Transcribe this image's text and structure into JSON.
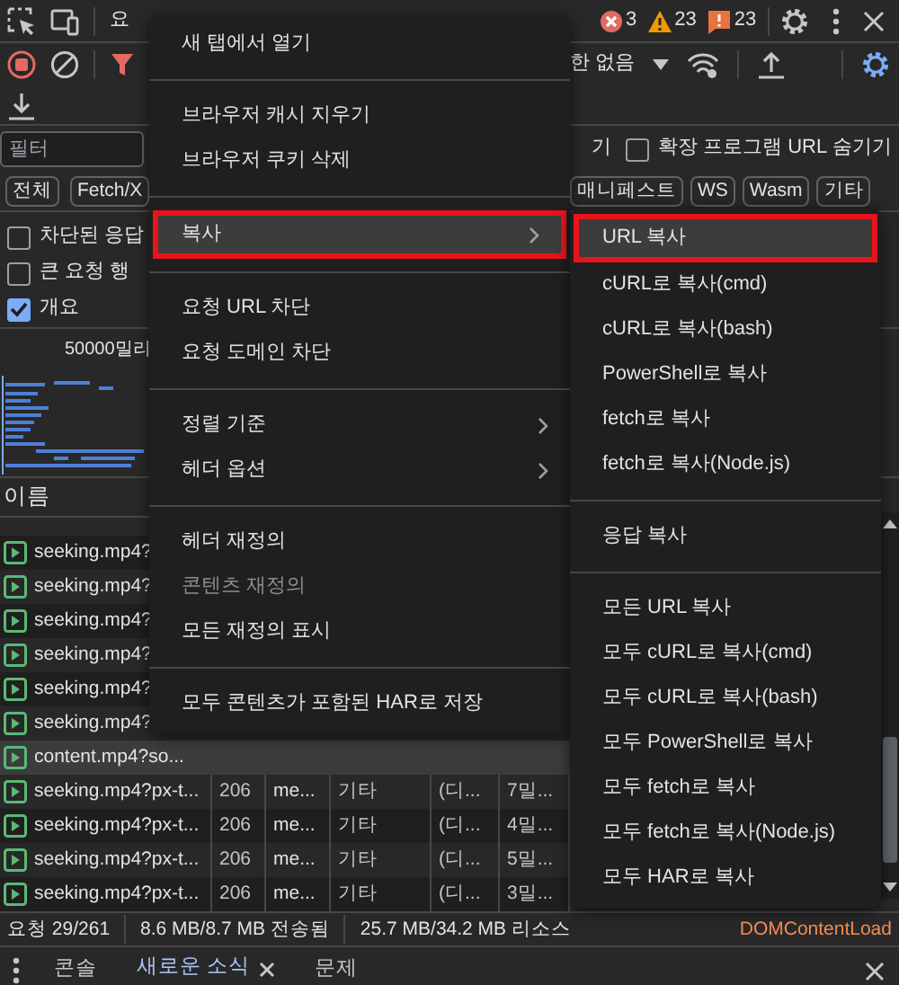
{
  "top_bar": {
    "tab_partial": "요",
    "errors": "3",
    "warnings": "23",
    "issues": "23"
  },
  "toolbar": {
    "throttle_partial": "한 없음"
  },
  "filter_row": {
    "placeholder": "필터",
    "partial_label": "기",
    "hide_extension_urls": {
      "label": "확장 프로그램 URL 숨기기",
      "checked": false
    }
  },
  "type_chips_left": [
    "전체",
    "Fetch/X"
  ],
  "type_chips_right": [
    "매니페스트",
    "WS",
    "Wasm",
    "기타"
  ],
  "options": [
    {
      "label": "차단된 응답",
      "checked": false
    },
    {
      "label": "큰 요청 행",
      "checked": false
    },
    {
      "label": "개요",
      "checked": true
    }
  ],
  "overview": {
    "tick": "50000밀리"
  },
  "table": {
    "columns": [
      "이름"
    ],
    "rows": [
      {
        "name": "seeking.mp4?",
        "selected": false
      },
      {
        "name": "seeking.mp4?",
        "selected": false
      },
      {
        "name": "seeking.mp4?",
        "selected": false
      },
      {
        "name": "seeking.mp4?",
        "selected": false
      },
      {
        "name": "seeking.mp4?",
        "selected": false
      },
      {
        "name": "seeking.mp4?",
        "selected": false
      },
      {
        "name": "content.mp4?so...",
        "selected": true
      },
      {
        "name": "seeking.mp4?px-t...",
        "selected": false,
        "cells": [
          "206",
          "me...",
          "기타",
          "(디...",
          "7밀..."
        ]
      },
      {
        "name": "seeking.mp4?px-t...",
        "selected": false,
        "cells": [
          "206",
          "me...",
          "기타",
          "(디...",
          "4밀..."
        ]
      },
      {
        "name": "seeking.mp4?px-t...",
        "selected": false,
        "cells": [
          "206",
          "me...",
          "기타",
          "(디...",
          "5밀..."
        ]
      },
      {
        "name": "seeking.mp4?px-t...",
        "selected": false,
        "cells": [
          "206",
          "me...",
          "기타",
          "(디...",
          "3밀..."
        ]
      }
    ]
  },
  "status_bar": [
    {
      "kind": "plain",
      "text": "요청 29/261"
    },
    {
      "kind": "plain",
      "text": "8.6 MB/8.7 MB 전송됨"
    },
    {
      "kind": "plain",
      "text": "25.7 MB/34.2 MB 리소스"
    },
    {
      "kind": "event",
      "text": "DOMContentLoad"
    }
  ],
  "drawer": {
    "tabs": [
      {
        "label": "콘솔",
        "selected": false,
        "closable": false
      },
      {
        "label": "새로운 소식",
        "selected": true,
        "closable": true
      },
      {
        "label": "문제",
        "selected": false,
        "closable": false
      }
    ]
  },
  "context_menu": {
    "items": [
      {
        "kind": "item",
        "label": "새 탭에서 열기",
        "disabled": false,
        "submenu": false,
        "highlighted": false,
        "outlined": false
      },
      {
        "kind": "separator"
      },
      {
        "kind": "item",
        "label": "브라우저 캐시 지우기",
        "disabled": false,
        "submenu": false,
        "highlighted": false,
        "outlined": false
      },
      {
        "kind": "item",
        "label": "브라우저 쿠키 삭제",
        "disabled": false,
        "submenu": false,
        "highlighted": false,
        "outlined": false
      },
      {
        "kind": "separator"
      },
      {
        "kind": "item",
        "label": "복사",
        "disabled": false,
        "submenu": true,
        "highlighted": true,
        "outlined": true
      },
      {
        "kind": "separator"
      },
      {
        "kind": "item",
        "label": "요청 URL 차단",
        "disabled": false,
        "submenu": false,
        "highlighted": false,
        "outlined": false
      },
      {
        "kind": "item",
        "label": "요청 도메인 차단",
        "disabled": false,
        "submenu": false,
        "highlighted": false,
        "outlined": false
      },
      {
        "kind": "separator"
      },
      {
        "kind": "item",
        "label": "정렬 기준",
        "disabled": false,
        "submenu": true,
        "highlighted": false,
        "outlined": false
      },
      {
        "kind": "item",
        "label": "헤더 옵션",
        "disabled": false,
        "submenu": true,
        "highlighted": false,
        "outlined": false
      },
      {
        "kind": "separator"
      },
      {
        "kind": "item",
        "label": "헤더 재정의",
        "disabled": false,
        "submenu": false,
        "highlighted": false,
        "outlined": false
      },
      {
        "kind": "item",
        "label": "콘텐츠 재정의",
        "disabled": true,
        "submenu": false,
        "highlighted": false,
        "outlined": false
      },
      {
        "kind": "item",
        "label": "모든 재정의 표시",
        "disabled": false,
        "submenu": false,
        "highlighted": false,
        "outlined": false
      },
      {
        "kind": "separator"
      },
      {
        "kind": "item",
        "label": "모두 콘텐츠가 포함된 HAR로 저장",
        "disabled": false,
        "submenu": false,
        "highlighted": false,
        "outlined": false
      }
    ]
  },
  "copy_submenu": {
    "items": [
      {
        "kind": "item",
        "label": "URL 복사",
        "highlighted": true,
        "outlined": true
      },
      {
        "kind": "item",
        "label": "cURL로 복사(cmd)",
        "highlighted": false,
        "outlined": false
      },
      {
        "kind": "item",
        "label": "cURL로 복사(bash)",
        "highlighted": false,
        "outlined": false
      },
      {
        "kind": "item",
        "label": "PowerShell로 복사",
        "highlighted": false,
        "outlined": false
      },
      {
        "kind": "item",
        "label": "fetch로 복사",
        "highlighted": false,
        "outlined": false
      },
      {
        "kind": "item",
        "label": "fetch로 복사(Node.js)",
        "highlighted": false,
        "outlined": false
      },
      {
        "kind": "separator"
      },
      {
        "kind": "item",
        "label": "응답 복사",
        "highlighted": false,
        "outlined": false
      },
      {
        "kind": "separator"
      },
      {
        "kind": "item",
        "label": "모든 URL 복사",
        "highlighted": false,
        "outlined": false
      },
      {
        "kind": "item",
        "label": "모두 cURL로 복사(cmd)",
        "highlighted": false,
        "outlined": false
      },
      {
        "kind": "item",
        "label": "모두 cURL로 복사(bash)",
        "highlighted": false,
        "outlined": false
      },
      {
        "kind": "item",
        "label": "모두 PowerShell로 복사",
        "highlighted": false,
        "outlined": false
      },
      {
        "kind": "item",
        "label": "모두 fetch로 복사",
        "highlighted": false,
        "outlined": false
      },
      {
        "kind": "item",
        "label": "모두 fetch로 복사(Node.js)",
        "highlighted": false,
        "outlined": false
      },
      {
        "kind": "item",
        "label": "모두 HAR로 복사",
        "highlighted": false,
        "outlined": false
      }
    ]
  }
}
